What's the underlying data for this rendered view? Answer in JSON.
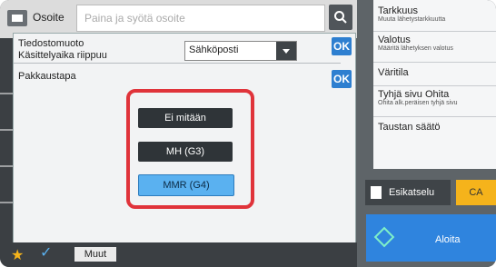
{
  "address": {
    "label": "Osoite",
    "placeholder": "Paina ja syötä osoite"
  },
  "dialog": {
    "row1_line1": "Tiedostomuoto",
    "row1_line2": "Käsittelyaika riippuu",
    "format_select_value": "Sähköposti",
    "ok_label": "OK",
    "compression_label": "Pakkaustapa",
    "options": [
      "Ei mitään",
      "MH (G3)",
      "MMR (G4)"
    ],
    "selected_option": "MMR (G4)"
  },
  "bottom": {
    "other_label": "Muut"
  },
  "right_panel": {
    "items": [
      {
        "main": "Tarkkuus",
        "sub": "Muuta lähetystarkkuutta"
      },
      {
        "main": "Valotus",
        "sub": "Määritä lähetyksen valotus"
      },
      {
        "main": "Väritila",
        "sub": ""
      },
      {
        "main": "Tyhjä sivu Ohita",
        "sub": "Ohita alk.peräisen tyhjä sivu"
      },
      {
        "main": "Taustan säätö",
        "sub": ""
      }
    ],
    "preview_label": "Esikatselu",
    "ca_label": "CA",
    "start_label": "Aloita"
  },
  "colors": {
    "accent_blue": "#2e7fd0",
    "highlight_red": "#e0333a",
    "selected_option": "#5ab1f0",
    "ca_button": "#f5b31b"
  }
}
